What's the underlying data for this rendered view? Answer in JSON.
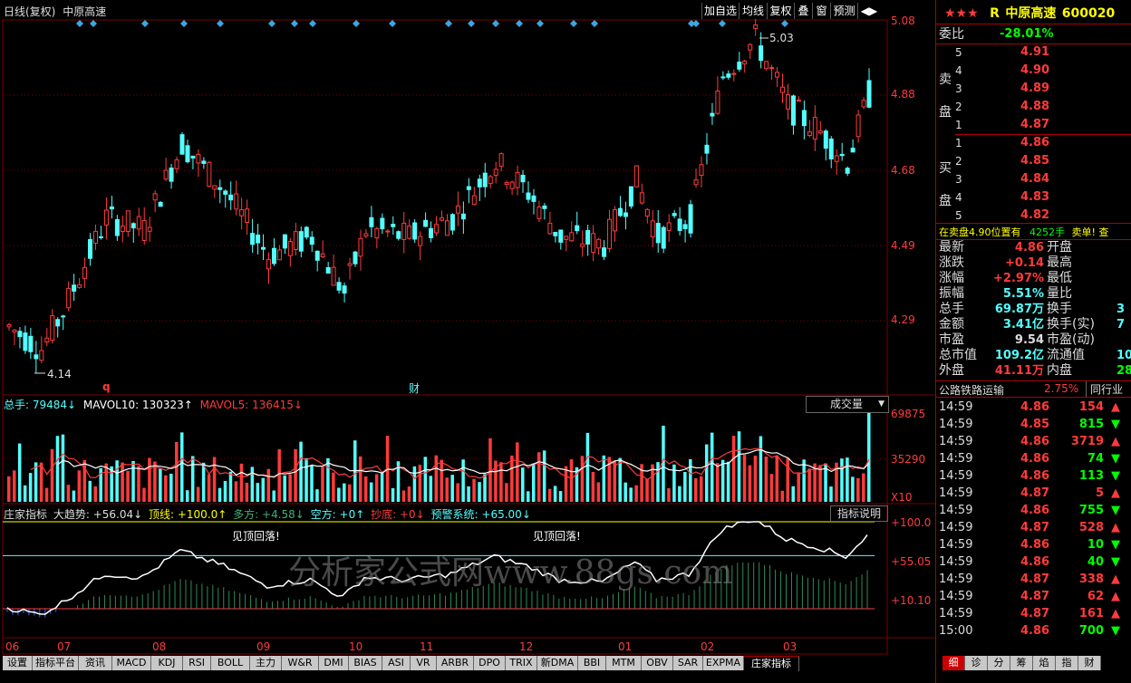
{
  "main_chart": {
    "title": "日线(复权)",
    "stock_name": "中原高速",
    "toolbar": [
      "加自选",
      "均线",
      "复权",
      "叠",
      "窗",
      "预测",
      "◀▶"
    ],
    "price_ticks": [
      "5.08",
      "4.88",
      "4.68",
      "4.49",
      "4.29"
    ],
    "high_label": "5.03",
    "low_label": "4.14",
    "marker_q": "q",
    "marker_cai": "财"
  },
  "volume_panel": {
    "total_label": "总手: 79484↓",
    "mavol10_label": "MAVOL10: 130323↑",
    "mavol5_label": "MAVOL5: 136415↓",
    "dropdown_label": "成交量",
    "ticks": [
      "69875",
      "35290",
      "X10"
    ]
  },
  "indicator_panel": {
    "name": "庄家指标",
    "trend": "大趋势: +56.04↓",
    "top_line": "顶线: +100.0↑",
    "long": "多方: +4.58↓",
    "short": "空方: +0↑",
    "bottom_fish": "抄底: +0↓",
    "warning": "预警系统: +65.00↓",
    "help_button": "指标说明",
    "ticks": [
      "+100.0",
      "+55.05",
      "+10.10"
    ],
    "annotation_1": "见顶回落!",
    "annotation_2": "见顶回落!"
  },
  "watermark": "分析家公式网www.88gs.com",
  "x_axis_months": [
    "06",
    "07",
    "08",
    "09",
    "10",
    "11",
    "12",
    "01",
    "02",
    "03"
  ],
  "bottom_tabs": [
    "设置",
    "指标平台",
    "资讯",
    "MACD",
    "KDJ",
    "RSI",
    "BOLL",
    "主力",
    "W&R",
    "DMI",
    "BIAS",
    "ASI",
    "VR",
    "ARBR",
    "DPO",
    "TRIX",
    "新DMA",
    "BBI",
    "MTM",
    "OBV",
    "SAR",
    "EXPMA",
    "庄家指标"
  ],
  "active_tab": "庄家指标",
  "right_panel": {
    "stars": "★★★",
    "flag": "R",
    "name": "中原高速",
    "code": "600020",
    "weibi_label": "委比",
    "weibi_value": "-28.01%",
    "sell_label": [
      "卖",
      "盘"
    ],
    "buy_label": [
      "买",
      "盘"
    ],
    "sell_rows": [
      {
        "level": "5",
        "price": "4.91"
      },
      {
        "level": "4",
        "price": "4.90"
      },
      {
        "level": "3",
        "price": "4.89"
      },
      {
        "level": "2",
        "price": "4.88"
      },
      {
        "level": "1",
        "price": "4.87"
      }
    ],
    "buy_rows": [
      {
        "level": "1",
        "price": "4.86"
      },
      {
        "level": "2",
        "price": "4.85"
      },
      {
        "level": "3",
        "price": "4.84"
      },
      {
        "level": "4",
        "price": "4.83"
      },
      {
        "level": "5",
        "price": "4.82"
      }
    ],
    "notice_a": "在卖盘4.90位置有",
    "notice_b": "4252手",
    "notice_c": "卖单! 查",
    "stats": [
      {
        "label": "最新",
        "value": "4.86",
        "label2": "开盘",
        "value2": ""
      },
      {
        "label": "涨跌",
        "value": "+0.14",
        "label2": "最高",
        "value2": ""
      },
      {
        "label": "涨幅",
        "value": "+2.97%",
        "label2": "最低",
        "value2": ""
      },
      {
        "label": "振幅",
        "value": "5.51%",
        "label2": "量比",
        "value2": ""
      },
      {
        "label": "总手",
        "value": "69.87万",
        "label2": "换手",
        "value2": "3"
      },
      {
        "label": "金额",
        "value": "3.41亿",
        "label2": "换手(实)",
        "value2": "7"
      },
      {
        "label": "市盈",
        "value": "9.54",
        "label2": "市盈(动)",
        "value2": ""
      },
      {
        "label": "总市值",
        "value": "109.2亿",
        "label2": "流通值",
        "value2": "10"
      },
      {
        "label": "外盘",
        "value": "41.11万",
        "label2": "内盘",
        "value2": "28"
      }
    ],
    "sector_name": "公路铁路运输",
    "sector_change": "2.75%",
    "sector_button": "同行业",
    "ticks": [
      {
        "time": "14:59",
        "price": "4.86",
        "vol": "154",
        "dir": "up"
      },
      {
        "time": "14:59",
        "price": "4.85",
        "vol": "815",
        "dir": "down"
      },
      {
        "time": "14:59",
        "price": "4.86",
        "vol": "3719",
        "dir": "up"
      },
      {
        "time": "14:59",
        "price": "4.86",
        "vol": "74",
        "dir": "down"
      },
      {
        "time": "14:59",
        "price": "4.86",
        "vol": "113",
        "dir": "down"
      },
      {
        "time": "14:59",
        "price": "4.87",
        "vol": "5",
        "dir": "up"
      },
      {
        "time": "14:59",
        "price": "4.86",
        "vol": "755",
        "dir": "down"
      },
      {
        "time": "14:59",
        "price": "4.87",
        "vol": "528",
        "dir": "up"
      },
      {
        "time": "14:59",
        "price": "4.86",
        "vol": "10",
        "dir": "down"
      },
      {
        "time": "14:59",
        "price": "4.86",
        "vol": "40",
        "dir": "down"
      },
      {
        "time": "14:59",
        "price": "4.87",
        "vol": "338",
        "dir": "up"
      },
      {
        "time": "14:59",
        "price": "4.87",
        "vol": "62",
        "dir": "up"
      },
      {
        "time": "14:59",
        "price": "4.87",
        "vol": "161",
        "dir": "up"
      },
      {
        "time": "15:00",
        "price": "4.86",
        "vol": "700",
        "dir": "down"
      }
    ],
    "bottom_tabs": [
      "细",
      "诊",
      "分",
      "筹",
      "焰",
      "指",
      "财"
    ]
  },
  "colors": {
    "up": "#ff3b3b",
    "down": "#54ffff",
    "grid": "#7a0000",
    "white": "#ffffff",
    "yellow": "#ffff00"
  }
}
